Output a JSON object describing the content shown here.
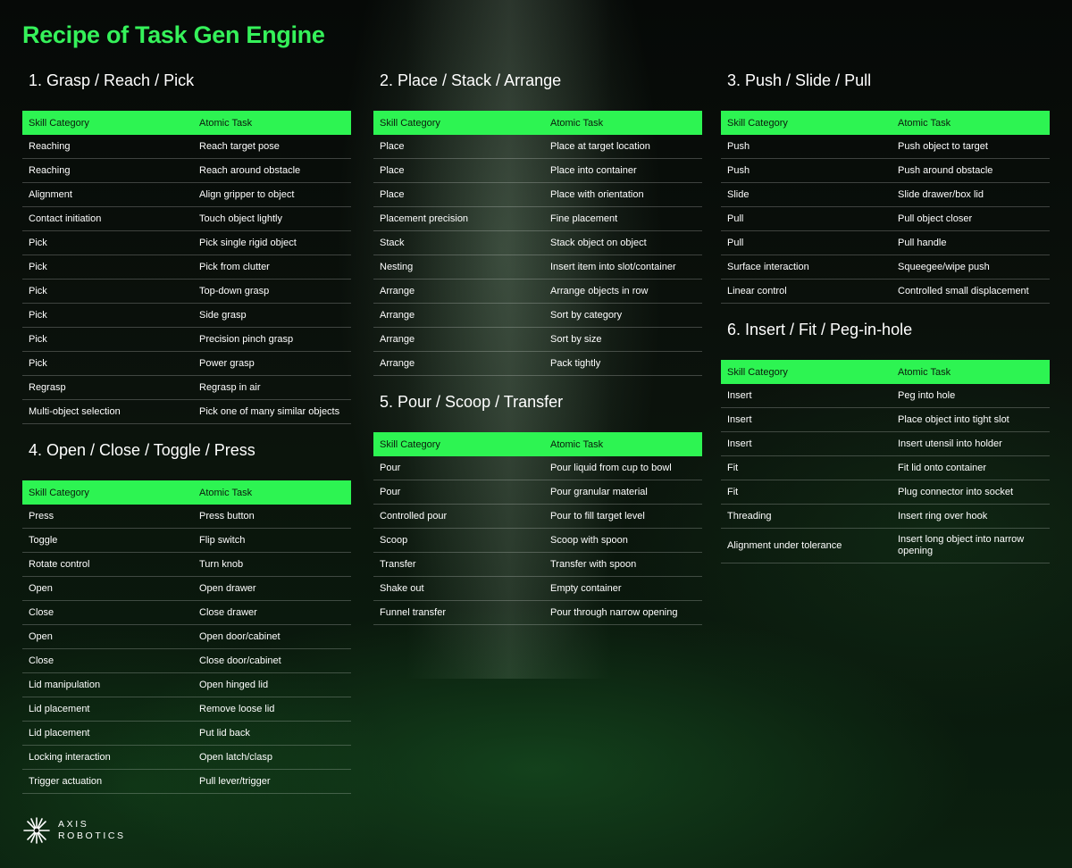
{
  "page": {
    "title": "Recipe of Task Gen Engine",
    "accent_color": "#2df452",
    "header_skill": "Skill Category",
    "header_task": "Atomic Task"
  },
  "sections": [
    {
      "heading": "1. Grasp / Reach / Pick",
      "rows": [
        [
          "Reaching",
          "Reach target pose"
        ],
        [
          "Reaching",
          "Reach around obstacle"
        ],
        [
          "Alignment",
          "Align gripper to object"
        ],
        [
          "Contact initiation",
          "Touch object lightly"
        ],
        [
          "Pick",
          "Pick single rigid object"
        ],
        [
          "Pick",
          "Pick from clutter"
        ],
        [
          "Pick",
          "Top-down grasp"
        ],
        [
          "Pick",
          "Side grasp"
        ],
        [
          "Pick",
          "Precision pinch grasp"
        ],
        [
          "Pick",
          "Power grasp"
        ],
        [
          "Regrasp",
          "Regrasp in air"
        ],
        [
          "Multi-object selection",
          "Pick one of many similar objects"
        ]
      ]
    },
    {
      "heading": "2. Place / Stack / Arrange",
      "rows": [
        [
          "Place",
          "Place at target location"
        ],
        [
          "Place",
          "Place into container"
        ],
        [
          "Place",
          "Place with orientation"
        ],
        [
          "Placement precision",
          "Fine placement"
        ],
        [
          "Stack",
          "Stack object on object"
        ],
        [
          "Nesting",
          "Insert item into slot/container"
        ],
        [
          "Arrange",
          "Arrange objects in row"
        ],
        [
          "Arrange",
          "Sort by category"
        ],
        [
          "Arrange",
          "Sort by size"
        ],
        [
          "Arrange",
          "Pack tightly"
        ]
      ]
    },
    {
      "heading": "3. Push / Slide / Pull",
      "rows": [
        [
          "Push",
          "Push object to target"
        ],
        [
          "Push",
          "Push around obstacle"
        ],
        [
          "Slide",
          "Slide drawer/box lid"
        ],
        [
          "Pull",
          "Pull object closer"
        ],
        [
          "Pull",
          "Pull handle"
        ],
        [
          "Surface interaction",
          "Squeegee/wipe push"
        ],
        [
          "Linear control",
          "Controlled small displacement"
        ]
      ]
    },
    {
      "heading": "4. Open / Close / Toggle / Press",
      "rows": [
        [
          "Press",
          "Press button"
        ],
        [
          "Toggle",
          "Flip switch"
        ],
        [
          "Rotate control",
          "Turn knob"
        ],
        [
          "Open",
          "Open drawer"
        ],
        [
          "Close",
          "Close drawer"
        ],
        [
          "Open",
          "Open door/cabinet"
        ],
        [
          "Close",
          "Close door/cabinet"
        ],
        [
          "Lid manipulation",
          "Open hinged lid"
        ],
        [
          "Lid placement",
          "Remove loose lid"
        ],
        [
          "Lid placement",
          "Put lid back"
        ],
        [
          "Locking interaction",
          "Open latch/clasp"
        ],
        [
          "Trigger actuation",
          "Pull lever/trigger"
        ]
      ]
    },
    {
      "heading": "5. Pour / Scoop / Transfer",
      "rows": [
        [
          "Pour",
          "Pour liquid from cup to bowl"
        ],
        [
          "Pour",
          "Pour granular material"
        ],
        [
          "Controlled pour",
          "Pour to fill target level"
        ],
        [
          "Scoop",
          "Scoop with spoon"
        ],
        [
          "Transfer",
          "Transfer with spoon"
        ],
        [
          "Shake out",
          "Empty container"
        ],
        [
          "Funnel transfer",
          "Pour through narrow opening"
        ]
      ]
    },
    {
      "heading": "6. Insert / Fit / Peg-in-hole",
      "rows": [
        [
          "Insert",
          "Peg into hole"
        ],
        [
          "Insert",
          "Place object into tight slot"
        ],
        [
          "Insert",
          "Insert utensil into holder"
        ],
        [
          "Fit",
          "Fit lid onto container"
        ],
        [
          "Fit",
          "Plug connector into socket"
        ],
        [
          "Threading",
          "Insert ring over hook"
        ],
        [
          "Alignment under tolerance",
          "Insert long object into narrow opening"
        ]
      ]
    }
  ],
  "logo": {
    "line1": "AXIS",
    "line2": "ROBOTICS",
    "icon": "starburst-logo-icon"
  }
}
